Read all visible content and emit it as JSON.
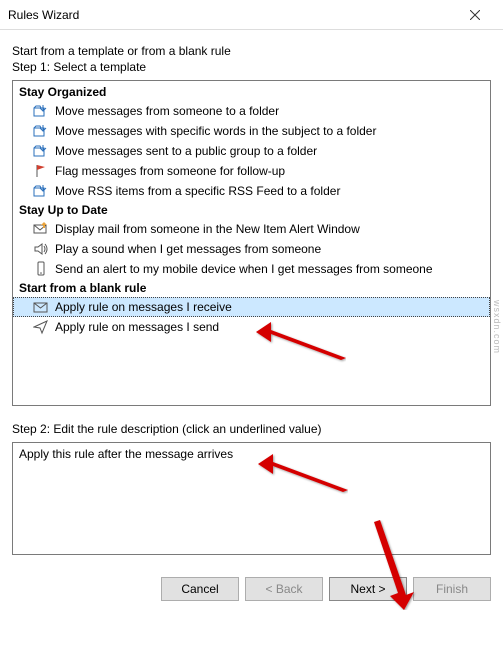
{
  "window": {
    "title": "Rules Wizard"
  },
  "step1": {
    "heading": "Start from a template or from a blank rule",
    "subheading": "Step 1: Select a template",
    "sections": {
      "organized": {
        "title": "Stay Organized",
        "items": [
          "Move messages from someone to a folder",
          "Move messages with specific words in the subject to a folder",
          "Move messages sent to a public group to a folder",
          "Flag messages from someone for follow-up",
          "Move RSS items from a specific RSS Feed to a folder"
        ]
      },
      "uptodate": {
        "title": "Stay Up to Date",
        "items": [
          "Display mail from someone in the New Item Alert Window",
          "Play a sound when I get messages from someone",
          "Send an alert to my mobile device when I get messages from someone"
        ]
      },
      "blank": {
        "title": "Start from a blank rule",
        "items": [
          "Apply rule on messages I receive",
          "Apply rule on messages I send"
        ]
      }
    }
  },
  "step2": {
    "heading": "Step 2: Edit the rule description (click an underlined value)",
    "description": "Apply this rule after the message arrives"
  },
  "buttons": {
    "cancel": "Cancel",
    "back": "< Back",
    "next": "Next >",
    "finish": "Finish"
  },
  "watermark": "wsxdn.com"
}
